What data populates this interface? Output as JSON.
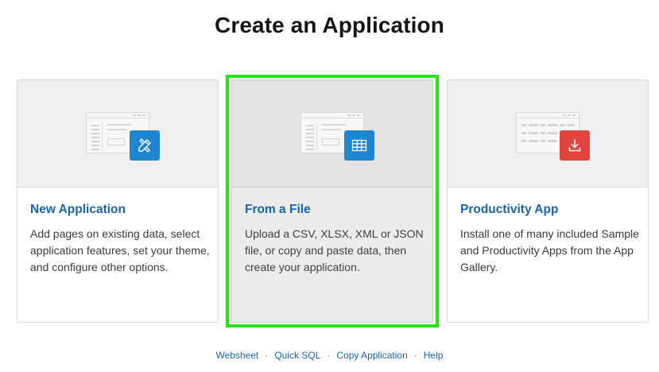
{
  "page": {
    "title": "Create an Application"
  },
  "cards": [
    {
      "title": "New Application",
      "description": "Add pages on existing data, select application features, set your theme, and configure other options.",
      "icon": "pencil-ruler-icon",
      "icon_color": "#1e85d1"
    },
    {
      "title": "From a File",
      "description": "Upload a CSV, XLSX, XML or JSON file, or copy and paste data, then create your application.",
      "icon": "table-grid-icon",
      "icon_color": "#1e85d1",
      "selected": true
    },
    {
      "title": "Productivity App",
      "description": "Install one of many included Sample and Productivity Apps from the App Gallery.",
      "icon": "download-icon",
      "icon_color": "#e0443c"
    }
  ],
  "footer_links": [
    {
      "label": "Websheet"
    },
    {
      "label": "Quick SQL"
    },
    {
      "label": "Copy Application"
    },
    {
      "label": "Help"
    }
  ],
  "separator": "·",
  "colors": {
    "link": "#1a63ad",
    "selection_outline": "#22e51a"
  }
}
